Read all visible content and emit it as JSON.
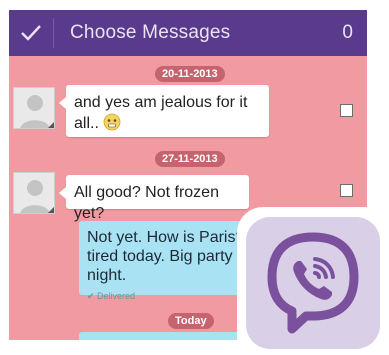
{
  "header": {
    "title": "Choose Messages",
    "count": "0",
    "icons": {
      "confirm": "check-icon"
    }
  },
  "messages": [
    {
      "date": "20-11-2013",
      "text": "and yes am jealous for it all..",
      "emoji": "worried-face-emoji"
    },
    {
      "date": "27-11-2013",
      "text": "All good? Not frozen yet?"
    }
  ],
  "outgoing": {
    "lines": [
      "Not yet. How is Paris?",
      "tired today. Big party la",
      "night."
    ],
    "status": "✔ Delivered"
  },
  "today_label": "Today",
  "logo": {
    "name": "viber-logo",
    "color": "#7b519d"
  },
  "colors": {
    "header": "#5a3a8c",
    "background": "#f29aa1",
    "outgoing_bubble": "#a9e2f3",
    "incoming_bubble": "#ffffff"
  }
}
